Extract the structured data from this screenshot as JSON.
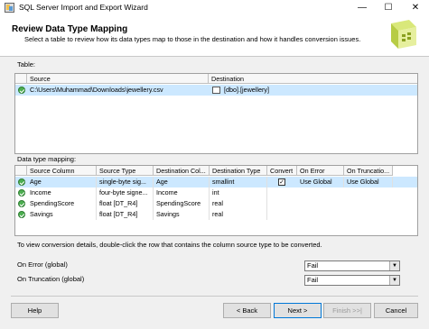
{
  "window": {
    "title": "SQL Server Import and Export Wizard",
    "minimize": "—",
    "maximize": "☐",
    "close": "✕"
  },
  "header": {
    "title": "Review Data Type Mapping",
    "subtitle": "Select a table to review how its data types map to those in the destination and how it handles conversion issues."
  },
  "table_section": {
    "label": "Table:",
    "columns": [
      "Source",
      "Destination"
    ],
    "rows": [
      {
        "source": "C:\\Users\\Muhammad\\Downloads\\jewellery.csv",
        "destination": "[dbo].[jewellery]",
        "selected": true
      }
    ]
  },
  "mapping_section": {
    "label": "Data type mapping:",
    "columns": [
      "Source Column",
      "Source Type",
      "Destination Col...",
      "Destination Type",
      "Convert",
      "On Error",
      "On Truncatio..."
    ],
    "rows": [
      {
        "source_column": "Age",
        "source_type": "single-byte sig...",
        "destination_column": "Age",
        "destination_type": "smallint",
        "convert": true,
        "on_error": "Use Global",
        "on_truncation": "Use Global",
        "selected": true
      },
      {
        "source_column": "Income",
        "source_type": "four-byte signe...",
        "destination_column": "Income",
        "destination_type": "int",
        "convert": false,
        "on_error": "",
        "on_truncation": "",
        "selected": false
      },
      {
        "source_column": "SpendingScore",
        "source_type": "float [DT_R4]",
        "destination_column": "SpendingScore",
        "destination_type": "real",
        "convert": false,
        "on_error": "",
        "on_truncation": "",
        "selected": false
      },
      {
        "source_column": "Savings",
        "source_type": "float [DT_R4]",
        "destination_column": "Savings",
        "destination_type": "real",
        "convert": false,
        "on_error": "",
        "on_truncation": "",
        "selected": false
      }
    ]
  },
  "hint": "To view conversion details, double-click the row that contains the column source type to be converted.",
  "global": {
    "on_error_label": "On Error (global)",
    "on_error_value": "Fail",
    "on_truncation_label": "On Truncation (global)",
    "on_truncation_value": "Fail"
  },
  "buttons": {
    "help": "Help",
    "back": "< Back",
    "next": "Next >",
    "finish": "Finish >>|",
    "cancel": "Cancel"
  },
  "colors": {
    "selection": "#cce8ff",
    "status_ok": "#4caf50"
  }
}
